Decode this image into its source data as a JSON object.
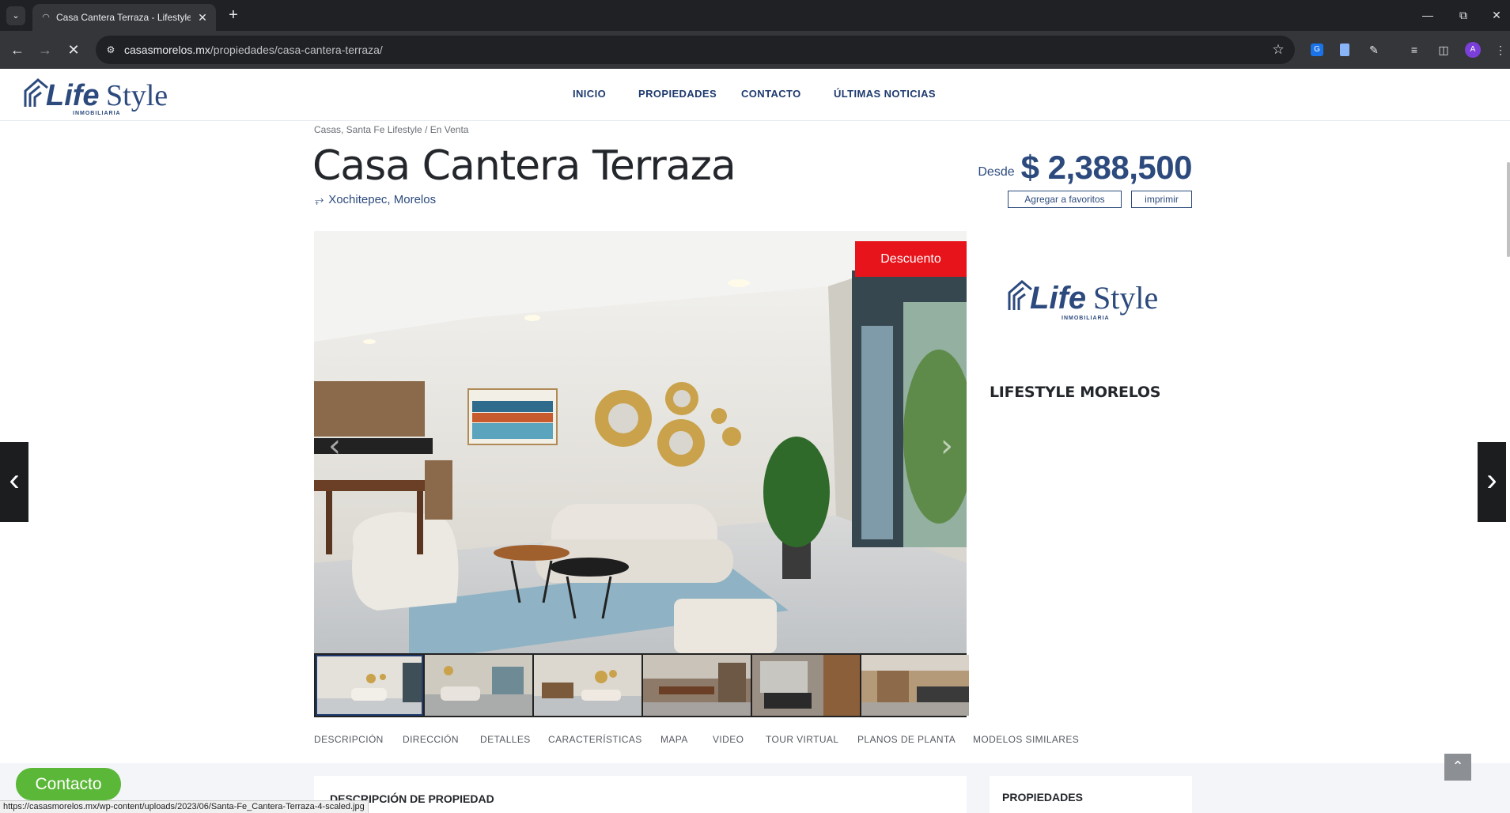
{
  "browser": {
    "tab_title": "Casa Cantera Terraza - Lifestyle",
    "url_host": "casasmorelos.mx",
    "url_path": "/propiedades/casa-cantera-terraza/",
    "status_url": "https://casasmorelos.mx/wp-content/uploads/2023/06/Santa-Fe_Cantera-Terraza-4-scaled.jpg",
    "profile_initial": "A"
  },
  "site": {
    "logo_text": "LifeStyle",
    "logo_sub": "INMOBILIARIA",
    "nav": [
      "INICIO",
      "PROPIEDADES",
      "CONTACTO",
      "ÚLTIMAS NOTICIAS"
    ],
    "brand_color": "#2c4a7d"
  },
  "property": {
    "breadcrumb": "Casas, Santa Fe Lifestyle / En Venta",
    "title": "Casa Cantera Terraza",
    "location": "Xochitepec, Morelos",
    "price_label": "Desde",
    "price": "$ 2,388,500",
    "favorites_label": "Agregar a favoritos",
    "print_label": "imprimir",
    "badge": "Descuento",
    "badge_color": "#e8141b"
  },
  "agent": {
    "name": "LIFESTYLE MORELOS"
  },
  "tabs": [
    "DESCRIPCIÓN",
    "DIRECCIÓN",
    "DETALLES",
    "CARACTERÍSTICAS",
    "MAPA",
    "VIDEO",
    "TOUR VIRTUAL",
    "PLANOS DE PLANTA",
    "MODELOS SIMILARES"
  ],
  "sections": {
    "description_title": "DESCRIPCIÓN DE PROPIEDAD",
    "properties_title": "PROPIEDADES"
  },
  "floating": {
    "contact_label": "Contacto"
  },
  "icons": {
    "tab_list": "chevron-down-icon",
    "close": "close-icon",
    "new_tab": "plus-icon",
    "back": "arrow-left-icon",
    "forward": "arrow-right-icon",
    "stop": "close-icon",
    "bookmark": "star-icon",
    "pin": "location-pin-icon",
    "to_top": "chevron-up-icon"
  }
}
